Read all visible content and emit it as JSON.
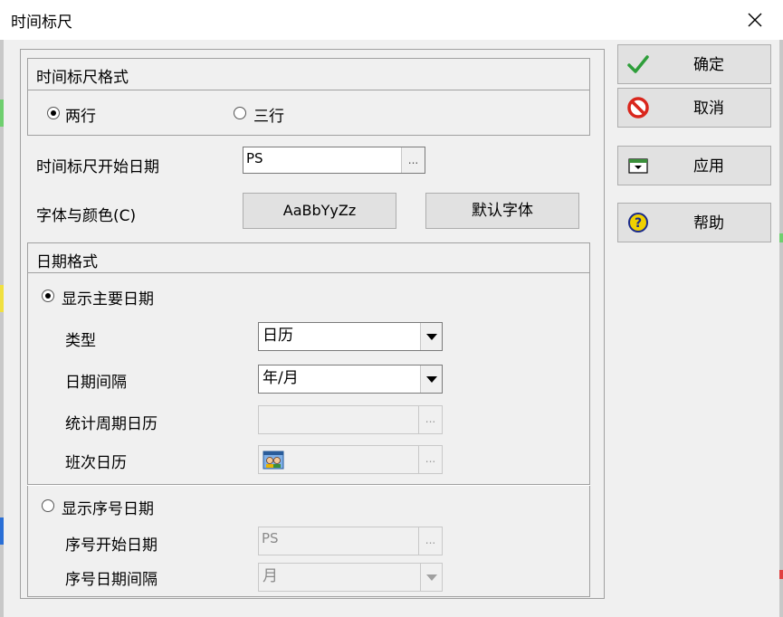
{
  "window": {
    "title": "时间标尺"
  },
  "scale_format": {
    "header": "时间标尺格式",
    "options": [
      {
        "label": "两行",
        "checked": true
      },
      {
        "label": "三行",
        "checked": false
      }
    ],
    "start_date_label": "时间标尺开始日期",
    "start_date_value": "PS",
    "ellipsis": "...",
    "font_color_label": "字体与颜色(C)",
    "font_sample_button": "AaBbYyZz",
    "default_font_button": "默认字体"
  },
  "date_format": {
    "header": "日期格式",
    "show_major_dates": {
      "label": "显示主要日期",
      "checked": true
    },
    "type_label": "类型",
    "type_value": "日历",
    "interval_label": "日期间隔",
    "interval_value": "年/月",
    "stat_calendar_label": "统计周期日历",
    "stat_calendar_value": "",
    "shift_calendar_label": "班次日历",
    "show_ordinal_dates": {
      "label": "显示序号日期",
      "checked": false
    },
    "ordinal_start_label": "序号开始日期",
    "ordinal_start_value": "PS",
    "ordinal_interval_label": "序号日期间隔",
    "ordinal_interval_value": "月"
  },
  "side_buttons": [
    {
      "label": "确定",
      "icon": "check-icon"
    },
    {
      "label": "取消",
      "icon": "cancel-icon"
    },
    {
      "label": "应用",
      "icon": "apply-icon"
    },
    {
      "label": "帮助",
      "icon": "help-icon"
    }
  ],
  "colors": {
    "accent_green": "#2e9e3a",
    "cancel_red": "#d9261c",
    "help_yellow": "#f0d000",
    "apply_green": "#3a8f3a"
  }
}
